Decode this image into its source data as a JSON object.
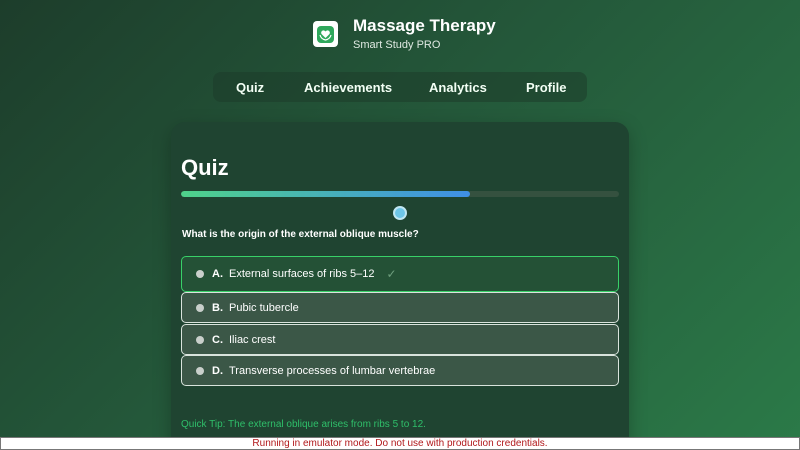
{
  "app": {
    "title": "Massage Therapy",
    "subtitle": "Smart Study PRO",
    "logo_icon": "heart-in-hands-icon"
  },
  "nav": {
    "items": [
      {
        "label": "Quiz"
      },
      {
        "label": "Achievements"
      },
      {
        "label": "Analytics"
      },
      {
        "label": "Profile"
      }
    ]
  },
  "quiz": {
    "heading": "Quiz",
    "progress_fraction": 0.66,
    "question": "What is the origin of the external oblique muscle?",
    "options": [
      {
        "letter": "A.",
        "text": "External surfaces of ribs 5–12",
        "selected": true
      },
      {
        "letter": "B.",
        "text": "Pubic tubercle",
        "selected": false
      },
      {
        "letter": "C.",
        "text": "Iliac crest",
        "selected": false
      },
      {
        "letter": "D.",
        "text": "Transverse processes of lumbar vertebrae",
        "selected": false
      }
    ],
    "check_mark": "✓",
    "tip": "Quick Tip: The external oblique arises from ribs 5 to 12."
  },
  "banner": {
    "text": "Running in emulator mode. Do not use with production credentials."
  },
  "colors": {
    "accent_green": "#38d168",
    "progress_start": "#4fd38a",
    "progress_end": "#3f8fe6",
    "banner_text": "#b1171a"
  }
}
